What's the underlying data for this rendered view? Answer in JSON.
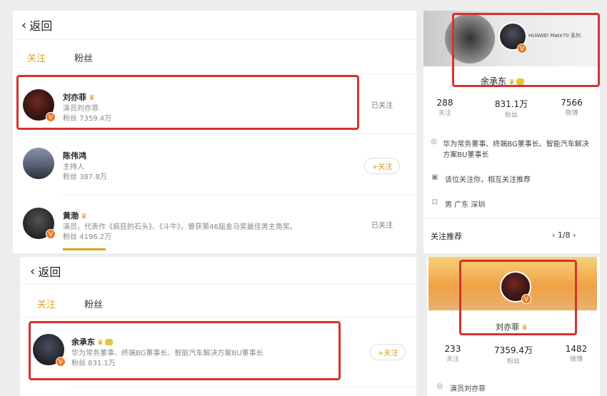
{
  "top": {
    "back_label": "返回",
    "tabs": {
      "follow": "关注",
      "fans": "粉丝"
    },
    "rows": [
      {
        "name": "刘亦菲",
        "line1": "演员刘亦菲",
        "line2": "粉丝 7359.4万",
        "state": "已关注"
      },
      {
        "name": "陈伟鸿",
        "line1": "主持人",
        "line2": "粉丝 387.8万",
        "state": "+关注"
      },
      {
        "name": "黄渤",
        "line1": "演员，代表作《疯狂的石头》、《斗牛》，曾获第46届金马奖最佳男主角奖。",
        "line2": "粉丝 4196.2万",
        "state": "已关注"
      }
    ]
  },
  "top_profile": {
    "name": "余承东",
    "banner_text": "HUAWEI Mate70 系列",
    "stats": [
      {
        "num": "288",
        "label": "关注"
      },
      {
        "num": "831.1万",
        "label": "粉丝"
      },
      {
        "num": "7566",
        "label": "微博"
      }
    ],
    "info": [
      {
        "icon": "◎",
        "text": "华为常务董事、终端BG董事长、智能汽车解决方案BU董事长"
      },
      {
        "icon": "▣",
        "text": "该位关注你，相互关注推荐"
      },
      {
        "icon": "⊡",
        "text": "男    广东 深圳"
      }
    ],
    "recommend": {
      "label": "关注推荐",
      "pager": "1/8"
    }
  },
  "bottom": {
    "back_label": "返回",
    "tabs": {
      "follow": "关注",
      "fans": "粉丝"
    },
    "row": {
      "name": "余承东",
      "line1": "华为常务董事、终端BG董事长、智能汽车解决方案BU董事长",
      "line2": "粉丝 831.1万",
      "state": "+关注"
    }
  },
  "bottom_profile": {
    "name": "刘亦菲",
    "stats": [
      {
        "num": "233",
        "label": "关注"
      },
      {
        "num": "7359.4万",
        "label": "粉丝"
      },
      {
        "num": "1482",
        "label": "微博"
      }
    ],
    "info_line": "演员刘亦菲"
  },
  "colors": {
    "accent": "#e0a21b",
    "highlight_box": "#d6322f",
    "v_badge": "#e87a25"
  }
}
